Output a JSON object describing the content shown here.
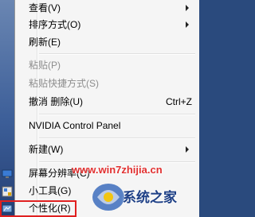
{
  "menu": {
    "items": [
      {
        "label": "查看(V)",
        "submenu": true
      },
      {
        "label": "排序方式(O)",
        "submenu": true
      },
      {
        "label": "刷新(E)"
      },
      {
        "label": "粘贴(P)",
        "disabled": true
      },
      {
        "label": "粘贴快捷方式(S)",
        "disabled": true
      },
      {
        "label": "撤消 删除(U)",
        "shortcut": "Ctrl+Z"
      },
      {
        "label": "NVIDIA Control Panel"
      },
      {
        "label": "新建(W)",
        "submenu": true
      },
      {
        "label": "屏幕分辨率(C)",
        "icon": "display-icon"
      },
      {
        "label": "小工具(G)",
        "icon": "gadget-icon"
      },
      {
        "label": "个性化(R)",
        "icon": "personalize-icon"
      }
    ]
  },
  "watermark": {
    "url": "www.win7zhijia.cn",
    "brand": "系统之家"
  },
  "colors": {
    "menu_bg": "#f5f5f5",
    "desktop": "#2a4a7d",
    "highlight": "#e02020",
    "watermark": "#e02020"
  }
}
